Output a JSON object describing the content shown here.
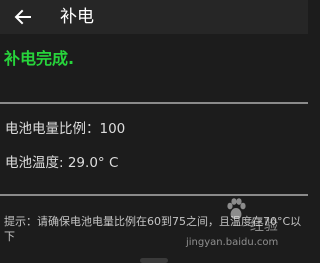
{
  "appbar": {
    "title": "补电",
    "back_icon": "arrow-left-icon"
  },
  "status": {
    "text": "补电完成.",
    "color": "#27d43b"
  },
  "battery": {
    "level_label": "电池电量比例：",
    "level_value": "100",
    "temp_label": "电池温度: ",
    "temp_value": "29.0° C"
  },
  "hint": {
    "text": "提示：请确保电池电量比例在60到75之间，且温度在70°C以下"
  },
  "watermark": {
    "brand_cn": "经验",
    "url": "jingyan.baidu.com",
    "icon": "baidu-paw-icon"
  }
}
